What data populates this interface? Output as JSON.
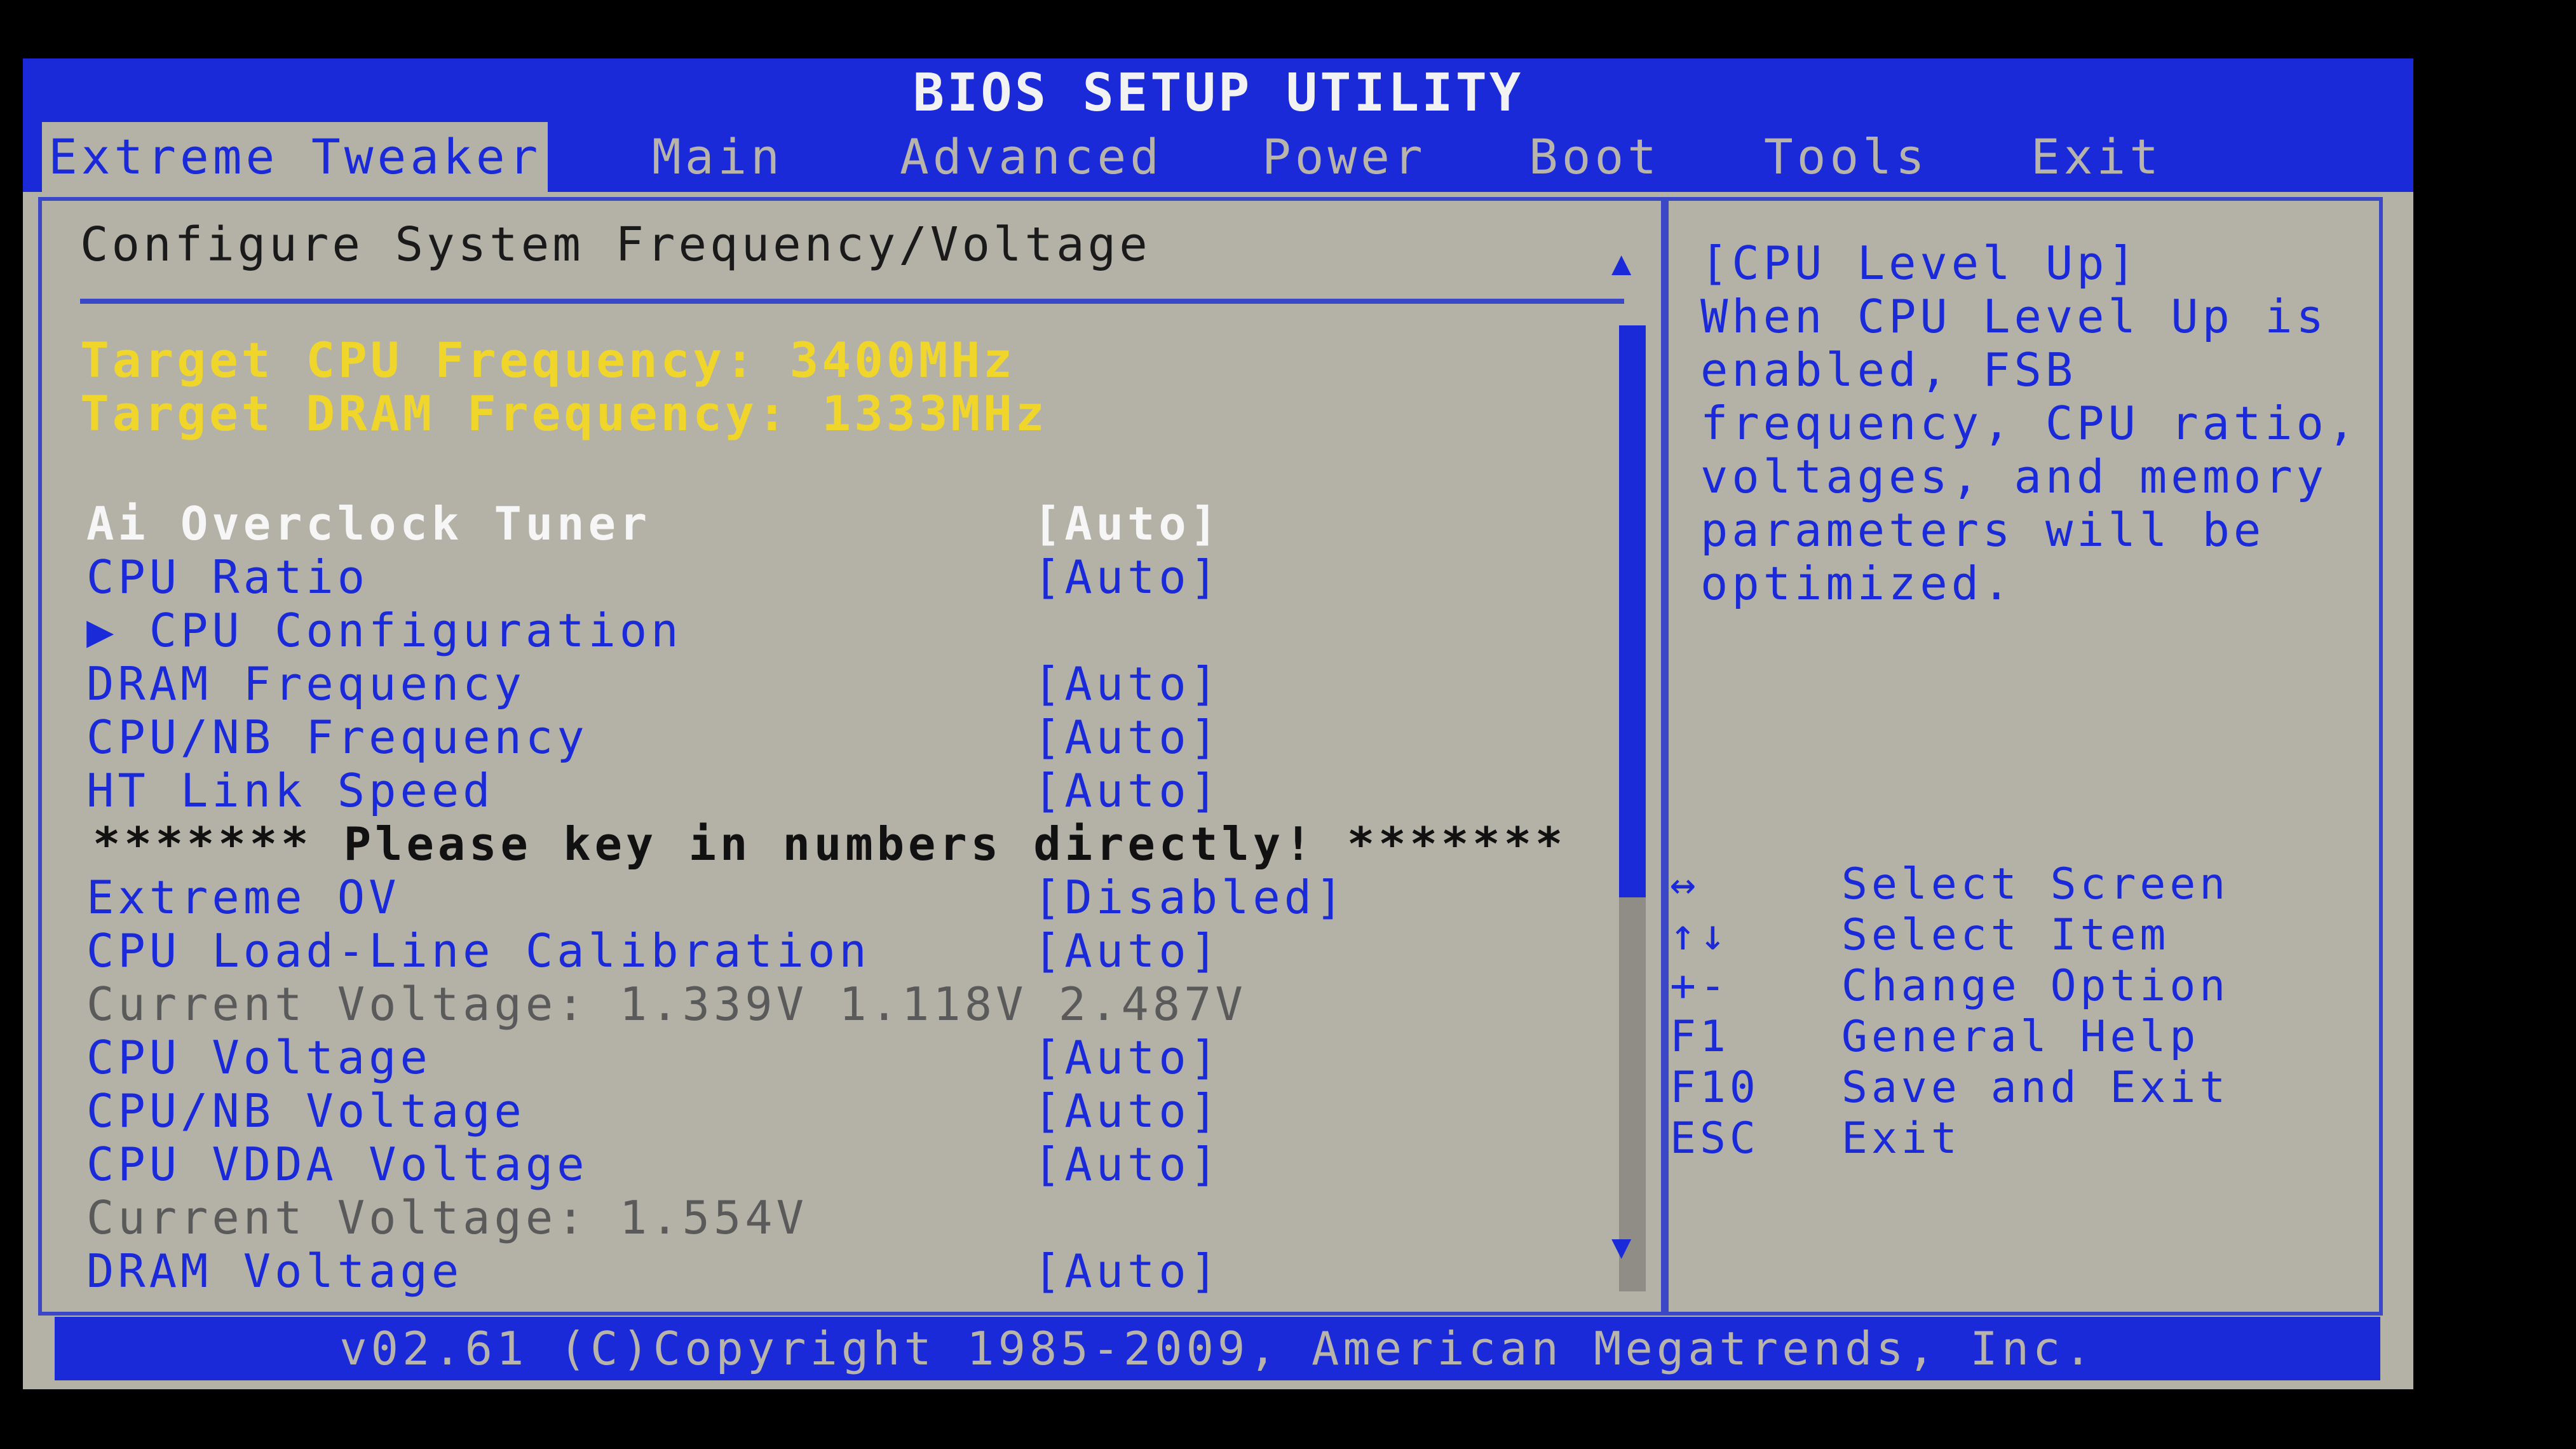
{
  "title": "BIOS SETUP UTILITY",
  "menu": {
    "tabs": [
      {
        "label": "Extreme Tweaker",
        "active": true
      },
      {
        "label": "Main"
      },
      {
        "label": "Advanced"
      },
      {
        "label": "Power"
      },
      {
        "label": "Boot"
      },
      {
        "label": "Tools"
      },
      {
        "label": "Exit"
      }
    ]
  },
  "main": {
    "section_title": "Configure System Frequency/Voltage",
    "target_cpu": "Target CPU Frequency: 3400MHz",
    "target_dram": "Target DRAM Frequency: 1333MHz",
    "items": [
      {
        "label": "Ai Overclock Tuner",
        "value": "[Auto]",
        "state": "selected"
      },
      {
        "label": "CPU Ratio",
        "value": "[Auto]"
      },
      {
        "label": "▶ CPU Configuration",
        "value": ""
      },
      {
        "label": "DRAM Frequency",
        "value": "[Auto]"
      },
      {
        "label": "CPU/NB Frequency",
        "value": "[Auto]"
      },
      {
        "label": "HT Link Speed",
        "value": "[Auto]"
      },
      {
        "label": "******* Please key in numbers directly! *******",
        "value": "",
        "state": "note"
      },
      {
        "label": "Extreme OV",
        "value": "[Disabled]"
      },
      {
        "label": "CPU Load-Line Calibration",
        "value": "[Auto]"
      },
      {
        "label": "Current Voltage: 1.339V  1.118V  2.487V",
        "value": "",
        "state": "static"
      },
      {
        "label": "CPU Voltage",
        "value": "[Auto]"
      },
      {
        "label": "CPU/NB Voltage",
        "value": "[Auto]"
      },
      {
        "label": "CPU VDDA Voltage",
        "value": "[Auto]"
      },
      {
        "label": "Current Voltage: 1.554V",
        "value": "",
        "state": "static"
      },
      {
        "label": "DRAM Voltage",
        "value": "[Auto]"
      }
    ],
    "scroll_position": 0.0
  },
  "help": {
    "lines": [
      "[CPU Level Up]",
      "When CPU Level Up is",
      "enabled, FSB",
      "frequency, CPU ratio,",
      "voltages, and memory",
      "parameters will be",
      "optimized."
    ],
    "keys": [
      {
        "key": "↔",
        "action": "Select Screen"
      },
      {
        "key": "↑↓",
        "action": "Select Item"
      },
      {
        "key": "+-",
        "action": "Change Option"
      },
      {
        "key": "F1",
        "action": "General Help"
      },
      {
        "key": "F10",
        "action": "Save and Exit"
      },
      {
        "key": "ESC",
        "action": "Exit"
      }
    ]
  },
  "footer": "v02.61 (C)Copyright 1985-2009, American Megatrends, Inc."
}
